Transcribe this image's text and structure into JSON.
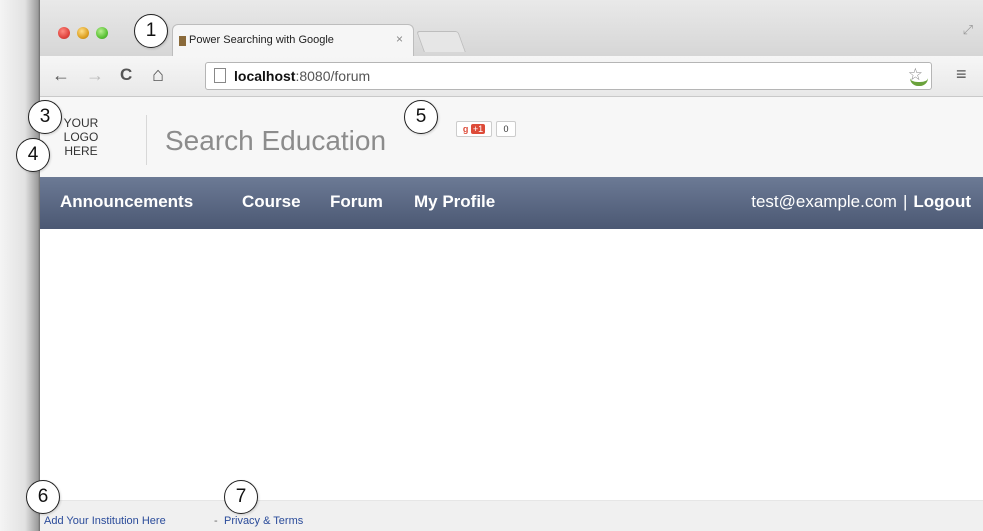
{
  "browser": {
    "tab_title": "Power Searching with Google",
    "tab_close": "×",
    "url_host": "localhost",
    "url_rest": ":8080/forum",
    "back": "←",
    "forward": "→",
    "reload": "C",
    "home": "⌂",
    "star": "☆",
    "menu": "≡",
    "resize": "⤢"
  },
  "header": {
    "logo_lines": [
      "YOUR",
      "LOGO",
      "HERE"
    ],
    "site_title": "Search Education",
    "gplus_label": "+1",
    "gplus_count": "0"
  },
  "nav": {
    "items": [
      "Announcements",
      "Course",
      "Forum",
      "My Profile"
    ],
    "user_email": "test@example.com",
    "separator": "|",
    "logout": "Logout"
  },
  "footer": {
    "institution": "Add Your Institution Here",
    "separator": "-",
    "privacy": "Privacy & Terms"
  },
  "callouts": [
    "1",
    "3",
    "4",
    "5",
    "6",
    "7"
  ]
}
